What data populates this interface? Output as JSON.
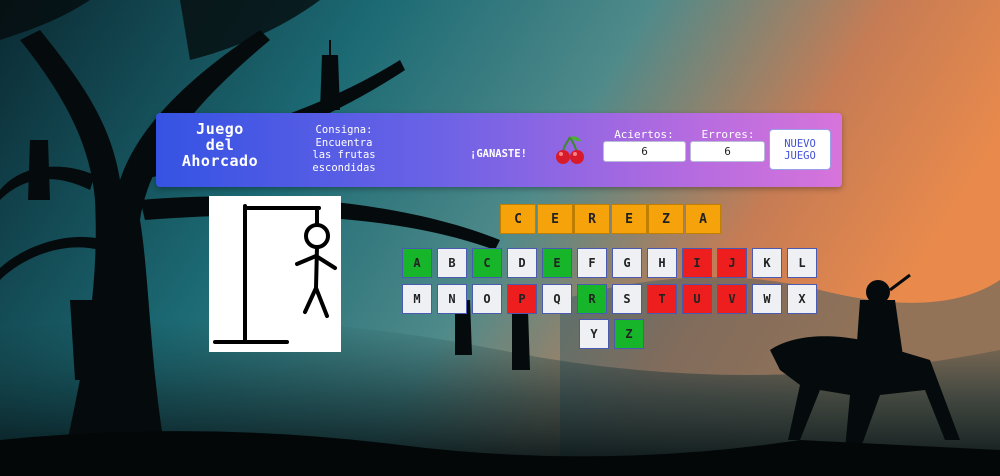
{
  "header": {
    "title_lines": [
      "Juego",
      "del",
      "Ahorcado"
    ],
    "consigna_lines": [
      "Consigna:",
      "Encuentra",
      "las frutas",
      "escondidas"
    ],
    "status": "¡GANASTE!",
    "fruit_icon": "cherry-icon",
    "aciertos_label": "Aciertos:",
    "aciertos_value": "6",
    "errores_label": "Errores:",
    "errores_value": "6",
    "new_game_lines": [
      "NUEVO",
      "JUEGO"
    ]
  },
  "word": [
    "C",
    "E",
    "R",
    "E",
    "Z",
    "A"
  ],
  "keyboard": {
    "row1": [
      {
        "letter": "A",
        "state": "hit"
      },
      {
        "letter": "B",
        "state": "neutral"
      },
      {
        "letter": "C",
        "state": "hit"
      },
      {
        "letter": "D",
        "state": "neutral"
      },
      {
        "letter": "E",
        "state": "hit"
      },
      {
        "letter": "F",
        "state": "neutral"
      },
      {
        "letter": "G",
        "state": "neutral"
      },
      {
        "letter": "H",
        "state": "neutral"
      },
      {
        "letter": "I",
        "state": "miss"
      },
      {
        "letter": "J",
        "state": "miss"
      },
      {
        "letter": "K",
        "state": "neutral"
      },
      {
        "letter": "L",
        "state": "neutral"
      }
    ],
    "row2": [
      {
        "letter": "M",
        "state": "neutral"
      },
      {
        "letter": "N",
        "state": "neutral"
      },
      {
        "letter": "O",
        "state": "neutral"
      },
      {
        "letter": "P",
        "state": "miss"
      },
      {
        "letter": "Q",
        "state": "neutral"
      },
      {
        "letter": "R",
        "state": "hit"
      },
      {
        "letter": "S",
        "state": "neutral"
      },
      {
        "letter": "T",
        "state": "miss"
      },
      {
        "letter": "U",
        "state": "miss"
      },
      {
        "letter": "V",
        "state": "miss"
      },
      {
        "letter": "W",
        "state": "neutral"
      },
      {
        "letter": "X",
        "state": "neutral"
      }
    ],
    "row3": [
      {
        "letter": "Y",
        "state": "neutral"
      },
      {
        "letter": "Z",
        "state": "hit"
      }
    ]
  },
  "colors": {
    "hit": "#16b52a",
    "miss": "#ee1e1e",
    "word_slot": "#f6a20a",
    "header_start": "#3553e3",
    "header_end": "#d774db"
  }
}
